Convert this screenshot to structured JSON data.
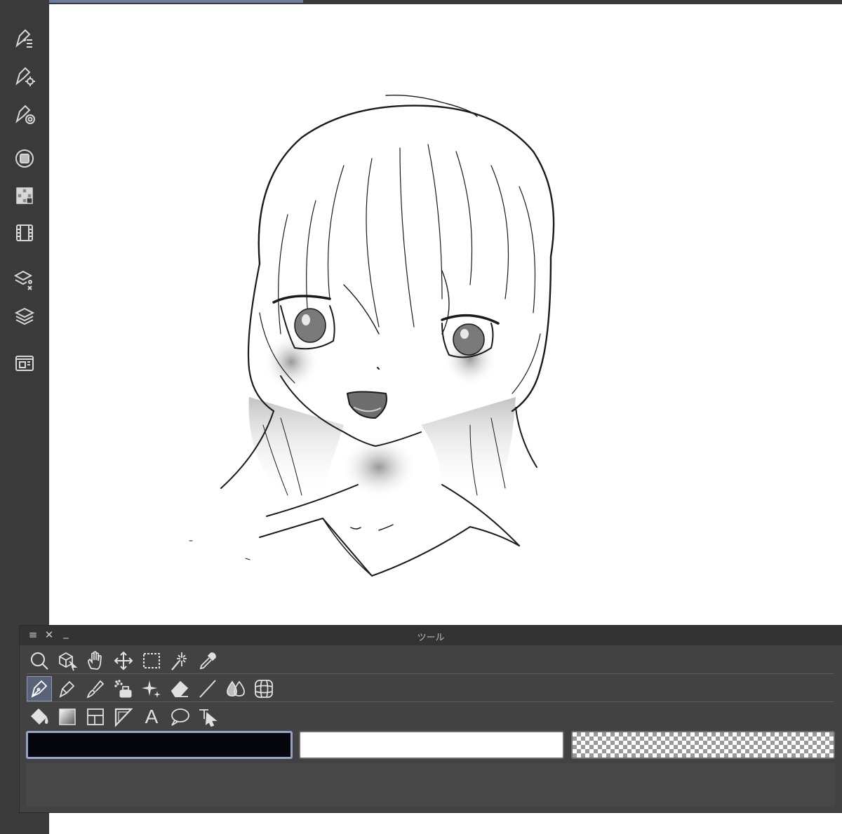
{
  "app": {
    "accent_color": "#6f7d9a",
    "panel_color": "#424242",
    "sidebar_color": "#3a3a3a"
  },
  "sidebar": {
    "icons": [
      "sub-tool-icon",
      "tool-property-icon",
      "brush-size-icon",
      "color-circle-icon",
      "color-set-icon",
      "timeline-icon",
      "layer-property-icon",
      "layer-icon",
      "navigator-icon"
    ]
  },
  "document": {
    "progress_fraction": 0.32,
    "content": "sketch-illustration"
  },
  "tool_panel": {
    "title": "ツール",
    "menu_icon": "≡",
    "close_icon": "✕",
    "minimize_icon": "_",
    "row1": [
      "zoom-tool-icon",
      "operation-tool-icon",
      "hand-tool-icon",
      "move-layer-tool-icon",
      "selection-tool-icon",
      "auto-select-tool-icon",
      "eyedropper-tool-icon"
    ],
    "row2": [
      "pen-tool-icon",
      "pencil-tool-icon",
      "brush-tool-icon",
      "airbrush-tool-icon",
      "decoration-tool-icon",
      "eraser-tool-icon",
      "line-tool-icon",
      "blend-tool-icon",
      "figure-ruler-tool-icon"
    ],
    "row3": [
      "fill-tool-icon",
      "gradient-tool-icon",
      "frame-border-tool-icon",
      "ruler-tool-icon",
      "text-tool-icon",
      "balloon-tool-icon",
      "correct-line-tool-icon"
    ],
    "active_tool": "pen-tool-icon",
    "text_tool_glyph": "A",
    "colors": {
      "main": "#06070c",
      "sub": "#ffffff",
      "transparent": "transparent"
    }
  }
}
